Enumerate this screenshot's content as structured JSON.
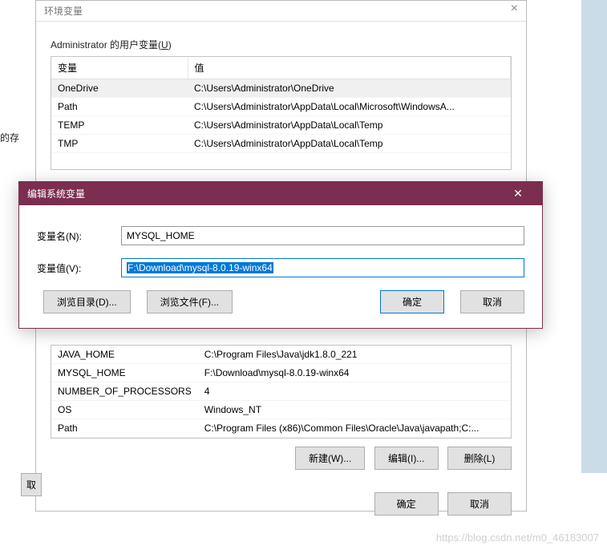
{
  "parent": {
    "title": "环境变量",
    "close_glyph": "×",
    "user_section_label_pre": "Administrator 的用户变量(",
    "user_section_label_key": "U",
    "user_section_label_post": ")",
    "col_variable": "变量",
    "col_value": "值",
    "user_rows": [
      {
        "var": "OneDrive",
        "val": "C:\\Users\\Administrator\\OneDrive",
        "sel": true
      },
      {
        "var": "Path",
        "val": "C:\\Users\\Administrator\\AppData\\Local\\Microsoft\\WindowsA..."
      },
      {
        "var": "TEMP",
        "val": "C:\\Users\\Administrator\\AppData\\Local\\Temp"
      },
      {
        "var": "TMP",
        "val": "C:\\Users\\Administrator\\AppData\\Local\\Temp"
      }
    ],
    "sys_rows": [
      {
        "var": "JAVA_HOME",
        "val": "C:\\Program Files\\Java\\jdk1.8.0_221"
      },
      {
        "var": "MYSQL_HOME",
        "val": "F:\\Download\\mysql-8.0.19-winx64"
      },
      {
        "var": "NUMBER_OF_PROCESSORS",
        "val": "4"
      },
      {
        "var": "OS",
        "val": "Windows_NT"
      },
      {
        "var": "Path",
        "val": "C:\\Program Files (x86)\\Common Files\\Oracle\\Java\\javapath;C:..."
      }
    ],
    "btn_new": "新建(W)...",
    "btn_edit": "编辑(I)...",
    "btn_delete": "删除(L)",
    "btn_ok": "确定",
    "btn_cancel": "取消"
  },
  "edit": {
    "title": "编辑系统变量",
    "close_glyph": "✕",
    "label_name": "变量名(N):",
    "label_value": "变量值(V):",
    "value_name": "MYSQL_HOME",
    "value_value": "F:\\Download\\mysql-8.0.19-winx64",
    "btn_browse_dir": "浏览目录(D)...",
    "btn_browse_file": "浏览文件(F)...",
    "btn_ok": "确定",
    "btn_cancel": "取消"
  },
  "truncated": {
    "left_label": "的存",
    "left_btn": "取"
  },
  "watermark": "https://blog.csdn.net/m0_46183007"
}
